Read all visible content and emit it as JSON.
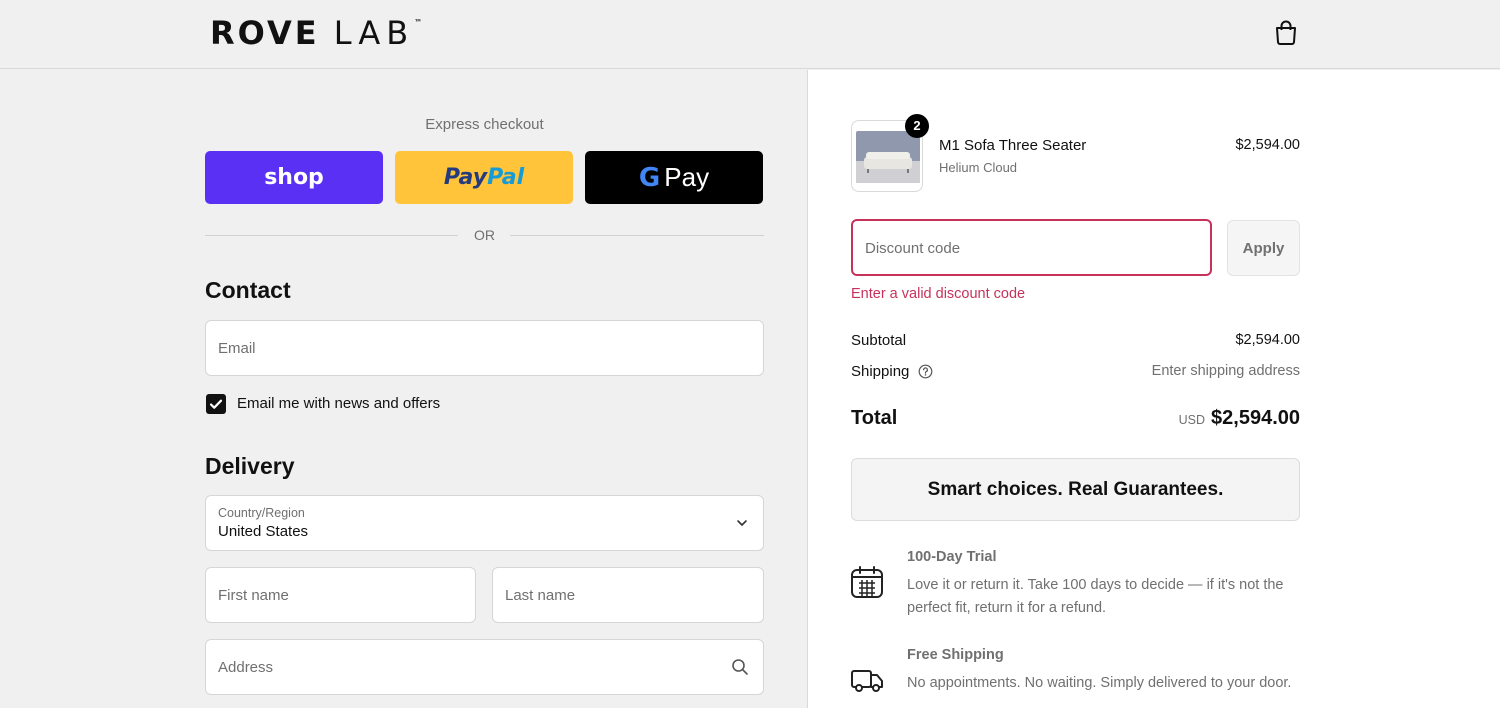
{
  "header": {
    "logo_main": "ROVE",
    "logo_secondary": "LAB",
    "logo_tm": "™"
  },
  "express": {
    "title": "Express checkout",
    "shop_label": "shop",
    "paypal_label_1": "Pay",
    "paypal_label_2": "Pal",
    "gpay_g": "G",
    "gpay_label": "Pay",
    "or_label": "OR"
  },
  "contact": {
    "title": "Contact",
    "email_placeholder": "Email",
    "newsletter_label": "Email me with news and offers",
    "newsletter_checked": true
  },
  "delivery": {
    "title": "Delivery",
    "country_label": "Country/Region",
    "country_value": "United States",
    "first_name_placeholder": "First name",
    "last_name_placeholder": "Last name",
    "address_placeholder": "Address"
  },
  "order": {
    "item": {
      "name": "M1 Sofa Three Seater",
      "variant": "Helium Cloud",
      "price": "$2,594.00",
      "quantity": "2"
    },
    "discount_placeholder": "Discount code",
    "apply_label": "Apply",
    "discount_error": "Enter a valid discount code",
    "subtotal_label": "Subtotal",
    "subtotal_value": "$2,594.00",
    "shipping_label": "Shipping",
    "shipping_value": "Enter shipping address",
    "total_label": "Total",
    "currency": "USD",
    "total_value": "$2,594.00"
  },
  "guarantees": {
    "banner": "Smart choices. Real Guarantees.",
    "features": [
      {
        "title": "100-Day Trial",
        "desc": "Love it or return it. Take 100 days to decide — if it's not the perfect fit, return it for a refund.",
        "icon": "calendar-icon"
      },
      {
        "title": "Free Shipping",
        "desc": "No appointments. No waiting. Simply delivered to your door.",
        "icon": "truck-icon"
      }
    ]
  },
  "colors": {
    "shop_purple": "#5a31f4",
    "paypal_yellow": "#ffc439",
    "gpay_black": "#000000",
    "error_red": "#c7325b",
    "muted_text": "#707070"
  }
}
